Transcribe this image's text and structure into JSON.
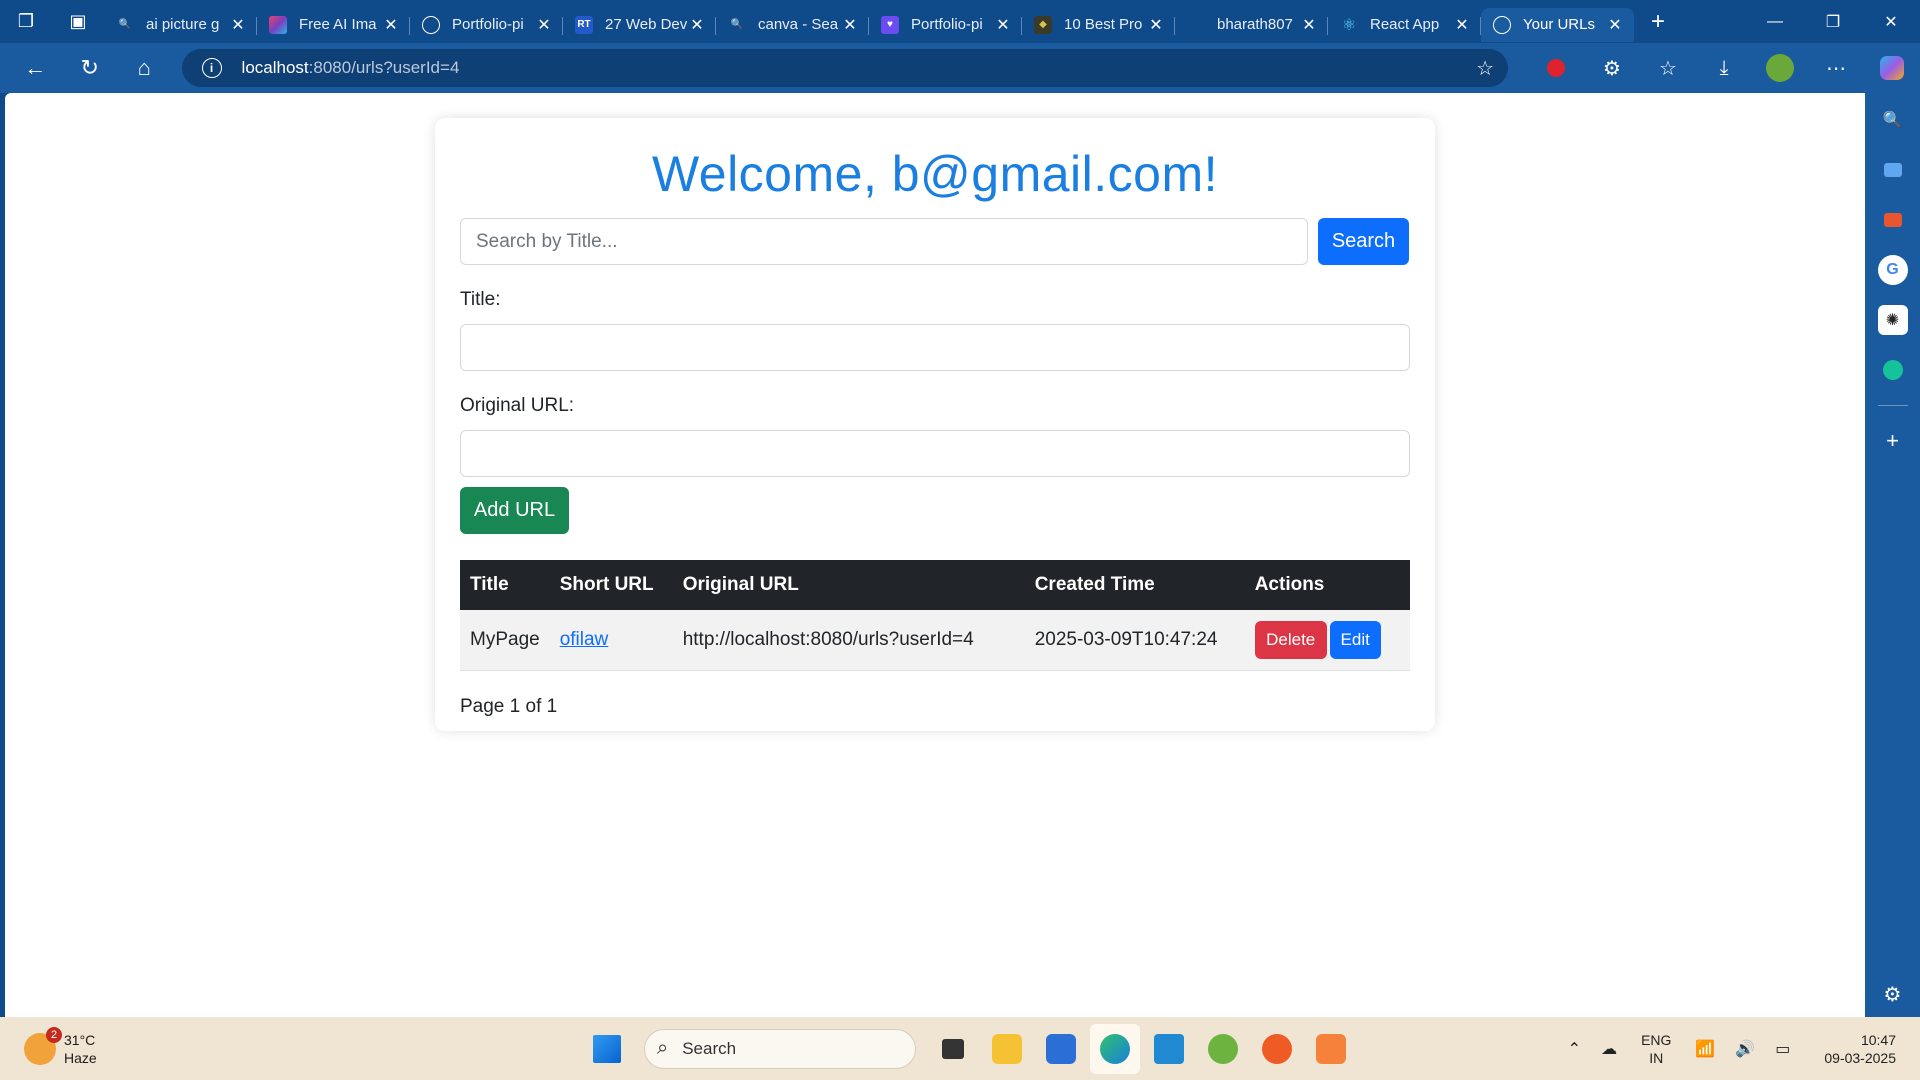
{
  "browser": {
    "tabs": [
      {
        "label": "ai picture g",
        "fav_color": "#0f4a8a"
      },
      {
        "label": "Free AI Ima",
        "fav_color": "#7a3fc0"
      },
      {
        "label": "Portfolio-pi",
        "fav_color": "#0f4a8a"
      },
      {
        "label": "27 Web Dev",
        "fav_color": "#2459c9"
      },
      {
        "label": "canva - Sea",
        "fav_color": "#0f4a8a"
      },
      {
        "label": "Portfolio-pi",
        "fav_color": "#6a4cf0"
      },
      {
        "label": "10 Best Pro",
        "fav_color": "#3a3a2a"
      },
      {
        "label": "bharath807",
        "fav_color": "#0f4a8a"
      },
      {
        "label": "React App",
        "fav_color": "#0f4a8a"
      },
      {
        "label": "Your URLs",
        "fav_color": "#1a5a9e"
      }
    ],
    "url_host": "localhost",
    "url_rest": ":8080/urls?userId=4"
  },
  "page": {
    "welcome": "Welcome, b@gmail.com!",
    "search_placeholder": "Search by Title...",
    "search_button": "Search",
    "title_label": "Title:",
    "original_url_label": "Original URL:",
    "add_button": "Add URL",
    "table_headers": [
      "Title",
      "Short URL",
      "Original URL",
      "Created Time",
      "Actions"
    ],
    "rows": [
      {
        "title": "MyPage",
        "short_url": "ofilaw",
        "original_url": "http://localhost:8080/urls?userId=4",
        "created": "2025-03-09T10:47:24",
        "delete_label": "Delete",
        "edit_label": "Edit"
      }
    ],
    "pagination": "Page 1 of 1"
  },
  "taskbar": {
    "weather_badge": "2",
    "temperature": "31°C",
    "condition": "Haze",
    "search_label": "Search",
    "lang_top": "ENG",
    "lang_bottom": "IN",
    "time": "10:47",
    "date": "09-03-2025"
  }
}
